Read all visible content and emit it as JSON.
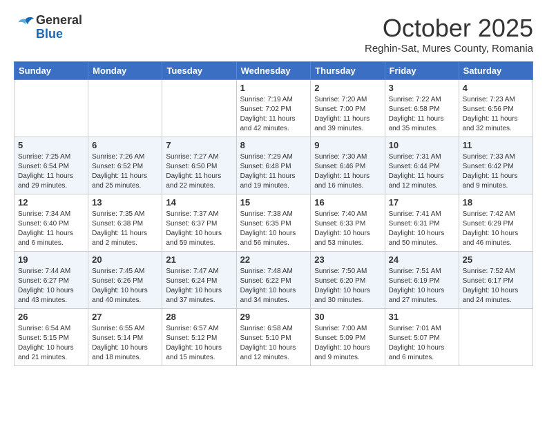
{
  "header": {
    "logo_line1": "General",
    "logo_line2": "Blue",
    "month": "October 2025",
    "location": "Reghin-Sat, Mures County, Romania"
  },
  "days_of_week": [
    "Sunday",
    "Monday",
    "Tuesday",
    "Wednesday",
    "Thursday",
    "Friday",
    "Saturday"
  ],
  "weeks": [
    [
      {
        "day": "",
        "info": ""
      },
      {
        "day": "",
        "info": ""
      },
      {
        "day": "",
        "info": ""
      },
      {
        "day": "1",
        "info": "Sunrise: 7:19 AM\nSunset: 7:02 PM\nDaylight: 11 hours\nand 42 minutes."
      },
      {
        "day": "2",
        "info": "Sunrise: 7:20 AM\nSunset: 7:00 PM\nDaylight: 11 hours\nand 39 minutes."
      },
      {
        "day": "3",
        "info": "Sunrise: 7:22 AM\nSunset: 6:58 PM\nDaylight: 11 hours\nand 35 minutes."
      },
      {
        "day": "4",
        "info": "Sunrise: 7:23 AM\nSunset: 6:56 PM\nDaylight: 11 hours\nand 32 minutes."
      }
    ],
    [
      {
        "day": "5",
        "info": "Sunrise: 7:25 AM\nSunset: 6:54 PM\nDaylight: 11 hours\nand 29 minutes."
      },
      {
        "day": "6",
        "info": "Sunrise: 7:26 AM\nSunset: 6:52 PM\nDaylight: 11 hours\nand 25 minutes."
      },
      {
        "day": "7",
        "info": "Sunrise: 7:27 AM\nSunset: 6:50 PM\nDaylight: 11 hours\nand 22 minutes."
      },
      {
        "day": "8",
        "info": "Sunrise: 7:29 AM\nSunset: 6:48 PM\nDaylight: 11 hours\nand 19 minutes."
      },
      {
        "day": "9",
        "info": "Sunrise: 7:30 AM\nSunset: 6:46 PM\nDaylight: 11 hours\nand 16 minutes."
      },
      {
        "day": "10",
        "info": "Sunrise: 7:31 AM\nSunset: 6:44 PM\nDaylight: 11 hours\nand 12 minutes."
      },
      {
        "day": "11",
        "info": "Sunrise: 7:33 AM\nSunset: 6:42 PM\nDaylight: 11 hours\nand 9 minutes."
      }
    ],
    [
      {
        "day": "12",
        "info": "Sunrise: 7:34 AM\nSunset: 6:40 PM\nDaylight: 11 hours\nand 6 minutes."
      },
      {
        "day": "13",
        "info": "Sunrise: 7:35 AM\nSunset: 6:38 PM\nDaylight: 11 hours\nand 2 minutes."
      },
      {
        "day": "14",
        "info": "Sunrise: 7:37 AM\nSunset: 6:37 PM\nDaylight: 10 hours\nand 59 minutes."
      },
      {
        "day": "15",
        "info": "Sunrise: 7:38 AM\nSunset: 6:35 PM\nDaylight: 10 hours\nand 56 minutes."
      },
      {
        "day": "16",
        "info": "Sunrise: 7:40 AM\nSunset: 6:33 PM\nDaylight: 10 hours\nand 53 minutes."
      },
      {
        "day": "17",
        "info": "Sunrise: 7:41 AM\nSunset: 6:31 PM\nDaylight: 10 hours\nand 50 minutes."
      },
      {
        "day": "18",
        "info": "Sunrise: 7:42 AM\nSunset: 6:29 PM\nDaylight: 10 hours\nand 46 minutes."
      }
    ],
    [
      {
        "day": "19",
        "info": "Sunrise: 7:44 AM\nSunset: 6:27 PM\nDaylight: 10 hours\nand 43 minutes."
      },
      {
        "day": "20",
        "info": "Sunrise: 7:45 AM\nSunset: 6:26 PM\nDaylight: 10 hours\nand 40 minutes."
      },
      {
        "day": "21",
        "info": "Sunrise: 7:47 AM\nSunset: 6:24 PM\nDaylight: 10 hours\nand 37 minutes."
      },
      {
        "day": "22",
        "info": "Sunrise: 7:48 AM\nSunset: 6:22 PM\nDaylight: 10 hours\nand 34 minutes."
      },
      {
        "day": "23",
        "info": "Sunrise: 7:50 AM\nSunset: 6:20 PM\nDaylight: 10 hours\nand 30 minutes."
      },
      {
        "day": "24",
        "info": "Sunrise: 7:51 AM\nSunset: 6:19 PM\nDaylight: 10 hours\nand 27 minutes."
      },
      {
        "day": "25",
        "info": "Sunrise: 7:52 AM\nSunset: 6:17 PM\nDaylight: 10 hours\nand 24 minutes."
      }
    ],
    [
      {
        "day": "26",
        "info": "Sunrise: 6:54 AM\nSunset: 5:15 PM\nDaylight: 10 hours\nand 21 minutes."
      },
      {
        "day": "27",
        "info": "Sunrise: 6:55 AM\nSunset: 5:14 PM\nDaylight: 10 hours\nand 18 minutes."
      },
      {
        "day": "28",
        "info": "Sunrise: 6:57 AM\nSunset: 5:12 PM\nDaylight: 10 hours\nand 15 minutes."
      },
      {
        "day": "29",
        "info": "Sunrise: 6:58 AM\nSunset: 5:10 PM\nDaylight: 10 hours\nand 12 minutes."
      },
      {
        "day": "30",
        "info": "Sunrise: 7:00 AM\nSunset: 5:09 PM\nDaylight: 10 hours\nand 9 minutes."
      },
      {
        "day": "31",
        "info": "Sunrise: 7:01 AM\nSunset: 5:07 PM\nDaylight: 10 hours\nand 6 minutes."
      },
      {
        "day": "",
        "info": ""
      }
    ]
  ]
}
